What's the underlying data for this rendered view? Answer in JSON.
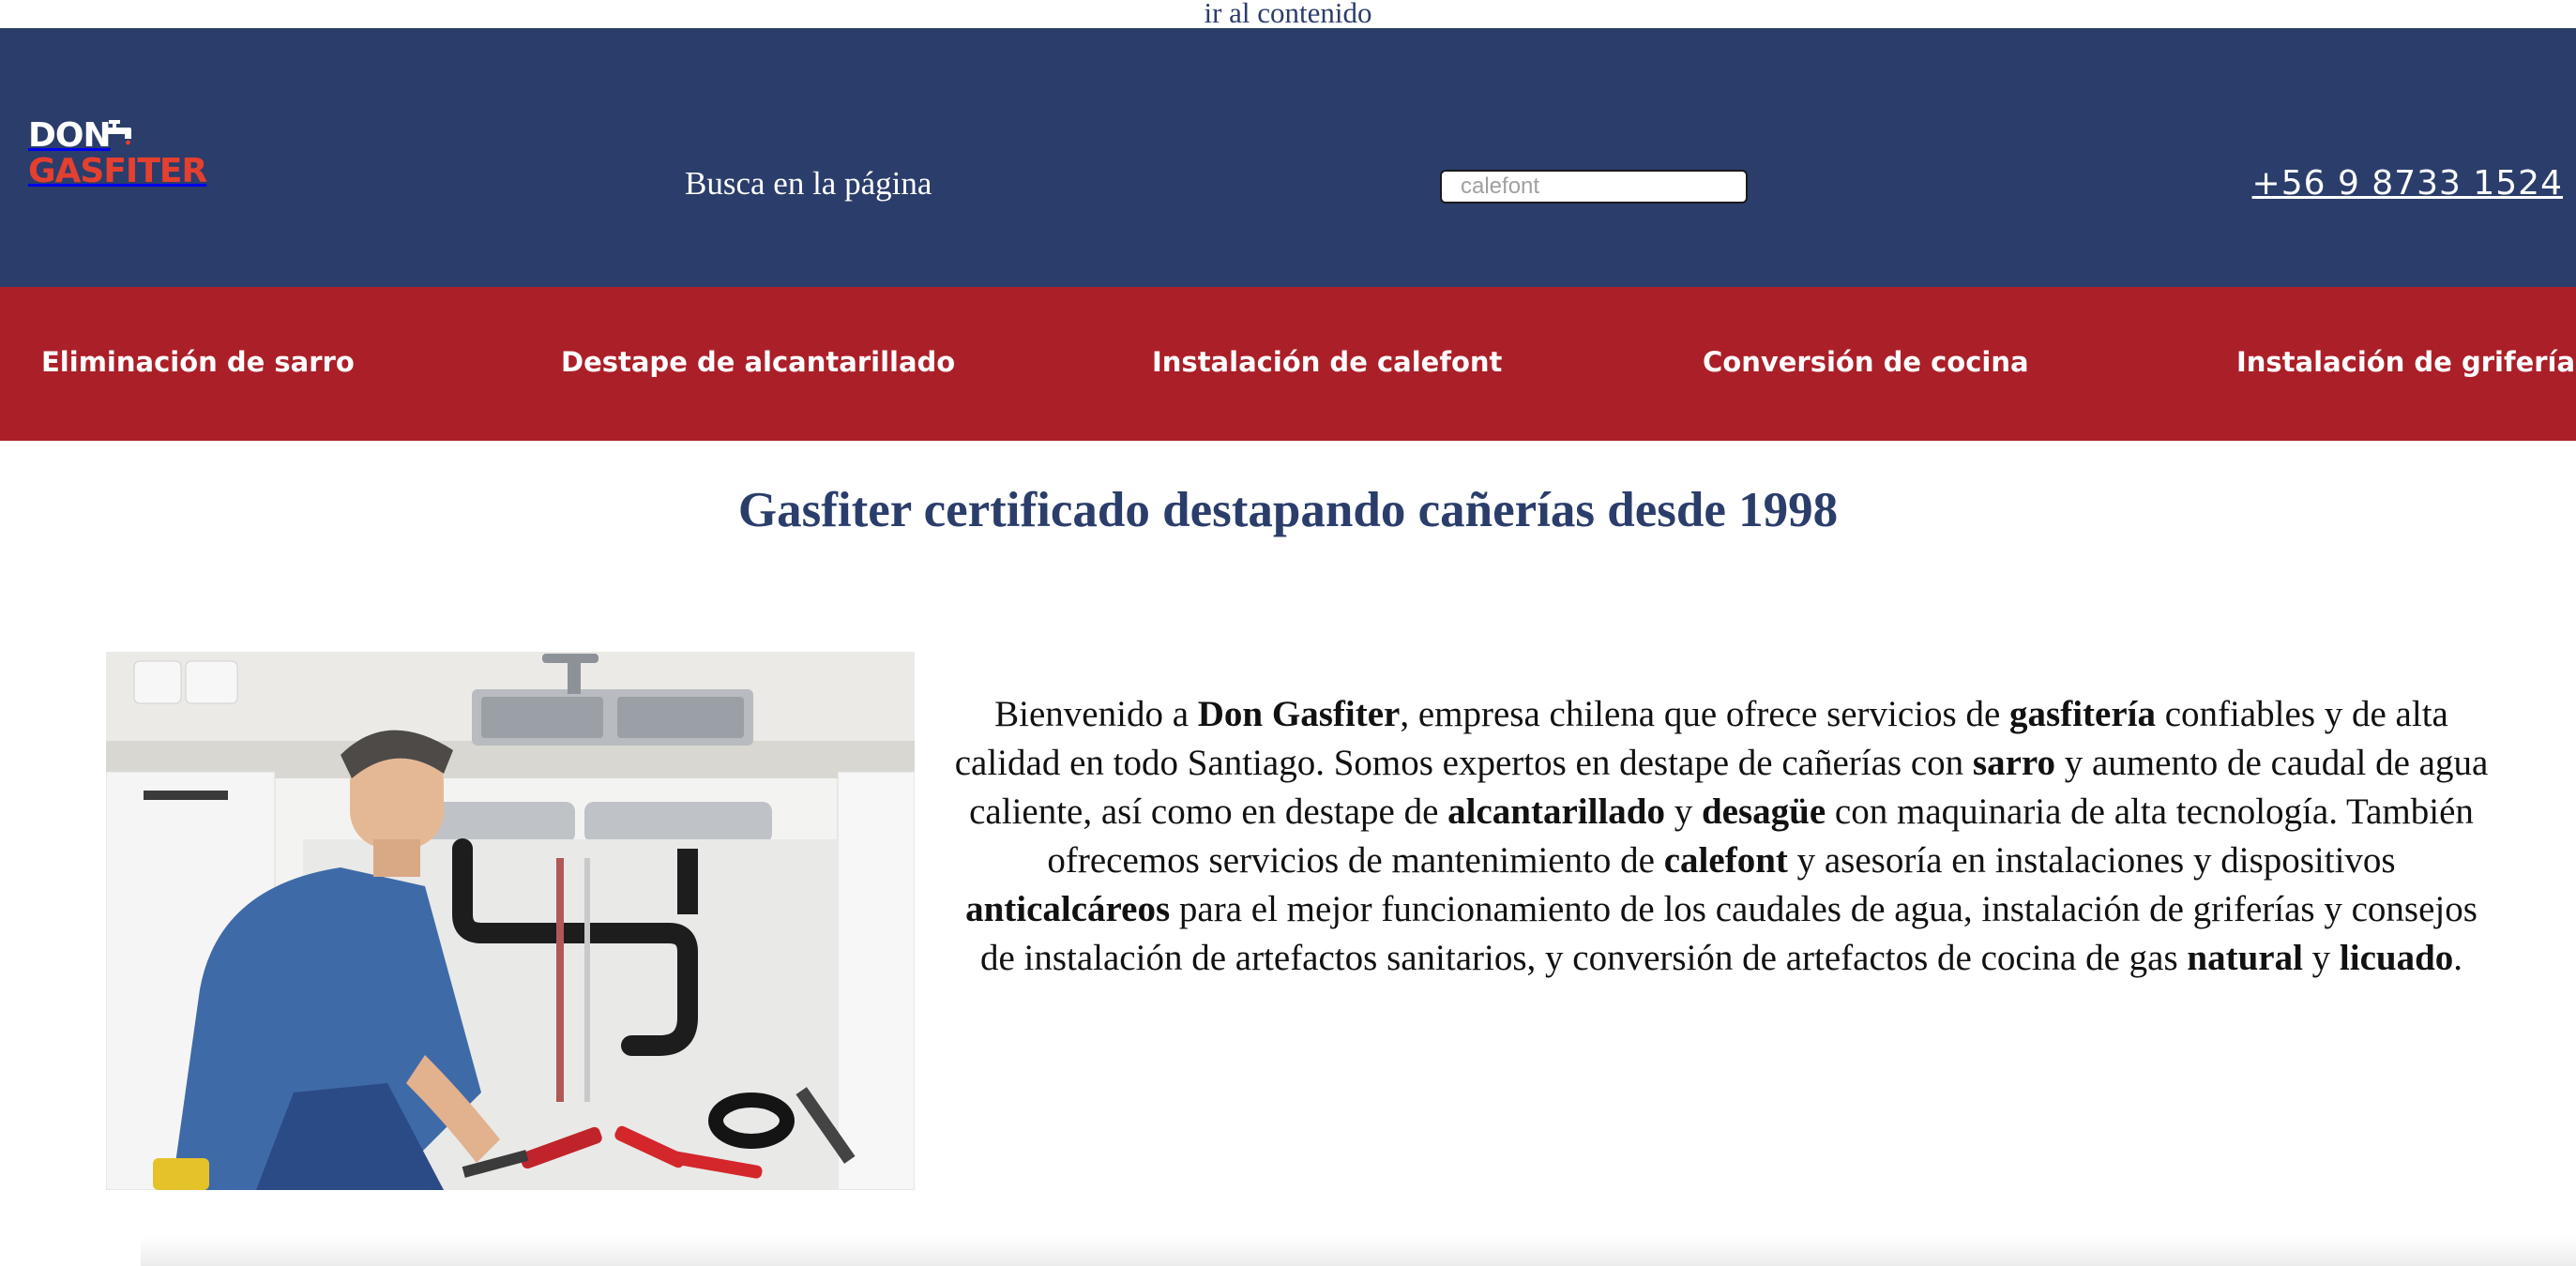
{
  "skip_link": "ir al contenido",
  "header": {
    "logo_line1": "DON",
    "logo_line2": "GASFITER",
    "search_label": "Busca en la página",
    "search_placeholder": "calefont",
    "phone": "+56 9 8733 1524"
  },
  "nav": {
    "items": [
      {
        "label": "Eliminación de sarro"
      },
      {
        "label": "Destape de alcantarillado"
      },
      {
        "label": "Instalación de calefont"
      },
      {
        "label": "Conversión de cocina"
      },
      {
        "label": "Instalación de griferías"
      }
    ]
  },
  "main": {
    "title": "Gasfiter certificado destapando cañerías desde 1998",
    "intro": {
      "p1": "Bienvenido a ",
      "b1": "Don Gasfiter",
      "p2": ", empresa chilena que ofrece servicios de ",
      "b2": "gasfitería",
      "p3": " confiables y de alta calidad en todo Santiago. Somos expertos en destape de cañerías con ",
      "b3": "sarro",
      "p4": " y aumento de caudal de agua caliente, así como en destape de ",
      "b4": "alcantarillado",
      "p5": " y ",
      "b5": "desagüe",
      "p6": " con maquinaria de alta tecnología. También ofrecemos servicios de mantenimiento de ",
      "b6": "calefont",
      "p7": " y asesoría en instalaciones y dispositivos ",
      "b7": "anticalcáreos",
      "p8": " para el mejor funcionamiento de los caudales de agua, instalación de griferías y consejos de instalación de artefactos sanitarios, y conversión de artefactos de cocina de gas ",
      "b8": "natural",
      "p9": " y ",
      "b9": "licuado",
      "p10": "."
    }
  },
  "colors": {
    "header_bg": "#2b3d6b",
    "nav_bg": "#ab1f29",
    "logo_accent": "#e4402f",
    "title_color": "#2b3d6b"
  },
  "icons": {
    "logo_icon": "faucet-icon",
    "hero": "plumber-under-sink-photo"
  }
}
